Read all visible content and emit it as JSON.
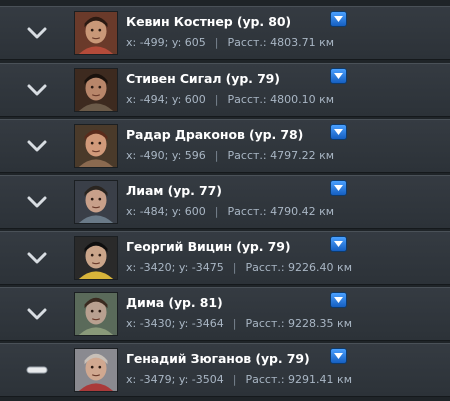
{
  "players": [
    {
      "name": "Кевин Костнер (ур. 80)",
      "coords": "x: -499; y: 605",
      "distance": "Расст.: 4803.71 км",
      "expanded": false,
      "avatar_icon": "portrait-icon"
    },
    {
      "name": "Стивен Сигал (ур. 79)",
      "coords": "x: -494; y: 600",
      "distance": "Расст.: 4800.10 км",
      "expanded": false,
      "avatar_icon": "portrait-icon"
    },
    {
      "name": "Радар Драконов (ур. 78)",
      "coords": "x: -490; y: 596",
      "distance": "Расст.: 4797.22 км",
      "expanded": false,
      "avatar_icon": "portrait-icon"
    },
    {
      "name": "Лиам (ур. 77)",
      "coords": "x: -484; y: 600",
      "distance": "Расст.: 4790.42 км",
      "expanded": false,
      "avatar_icon": "portrait-icon"
    },
    {
      "name": "Георгий Вицин (ур. 79)",
      "coords": "x: -3420; y: -3475",
      "distance": "Расст.: 9226.40 км",
      "expanded": false,
      "avatar_icon": "portrait-icon"
    },
    {
      "name": "Дима (ур. 81)",
      "coords": "x: -3430; y: -3464",
      "distance": "Расст.: 9228.35 км",
      "expanded": false,
      "avatar_icon": "portrait-icon"
    },
    {
      "name": "Генадий Зюганов (ур. 79)",
      "coords": "x: -3479; y: -3504",
      "distance": "Расст.: 9291.41 км",
      "expanded": true,
      "avatar_icon": "portrait-icon"
    }
  ],
  "icons": {
    "expand": "chevron-down-icon",
    "collapse": "minus-icon",
    "menu": "dropdown-arrow-icon"
  },
  "colors": {
    "row_bg": "#30363c",
    "name_text": "#ffffff",
    "info_text": "#a9b6c4",
    "menu_button": "#2a7fe6"
  }
}
